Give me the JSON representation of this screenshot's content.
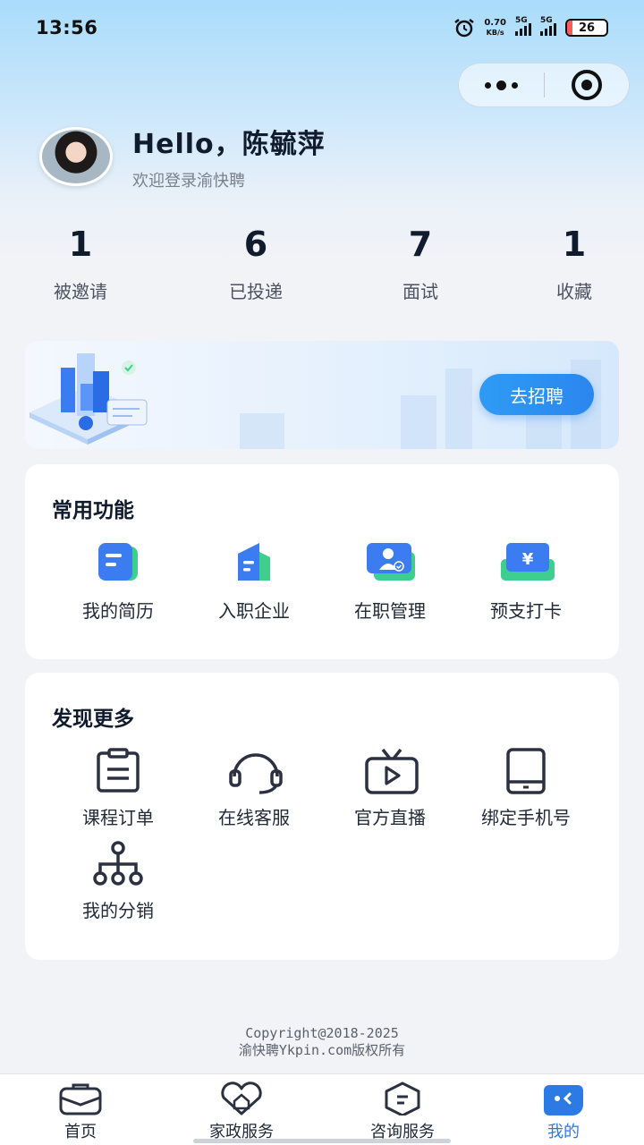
{
  "status_bar": {
    "time": "13:56",
    "net_speed_value": "0.70",
    "net_speed_unit": "KB/s",
    "signal1_label": "5G",
    "signal2_label": "5G",
    "battery": "26"
  },
  "profile": {
    "greeting": "Hello，陈毓萍",
    "welcome": "欢迎登录渝快聘"
  },
  "stats": [
    {
      "value": "1",
      "label": "被邀请"
    },
    {
      "value": "6",
      "label": "已投递"
    },
    {
      "value": "7",
      "label": "面试"
    },
    {
      "value": "1",
      "label": "收藏"
    }
  ],
  "banner": {
    "button_label": "去招聘"
  },
  "common_functions": {
    "title": "常用功能",
    "items": [
      {
        "label": "我的简历",
        "icon": "resume-icon"
      },
      {
        "label": "入职企业",
        "icon": "building-icon"
      },
      {
        "label": "在职管理",
        "icon": "employee-card-icon"
      },
      {
        "label": "预支打卡",
        "icon": "yen-card-icon"
      }
    ]
  },
  "discover_more": {
    "title": "发现更多",
    "items": [
      {
        "label": "课程订单",
        "icon": "clipboard-icon"
      },
      {
        "label": "在线客服",
        "icon": "headset-icon"
      },
      {
        "label": "官方直播",
        "icon": "tv-play-icon"
      },
      {
        "label": "绑定手机号",
        "icon": "phone-icon"
      },
      {
        "label": "我的分销",
        "icon": "network-icon"
      }
    ]
  },
  "footer": {
    "line1": "Copyright@2018-2025",
    "line2": "渝快聘Ykpin.com版权所有"
  },
  "tabbar": [
    {
      "label": "首页",
      "icon": "briefcase-icon",
      "active": false
    },
    {
      "label": "家政服务",
      "icon": "heart-house-icon",
      "active": false
    },
    {
      "label": "咨询服务",
      "icon": "hexagon-chat-icon",
      "active": false
    },
    {
      "label": "我的",
      "icon": "profile-face-icon",
      "active": true
    }
  ],
  "colors": {
    "accent": "#2c7be5",
    "icon_blue": "#3b7cf0",
    "icon_green": "#3ecf8e",
    "text_dark": "#111b2e"
  }
}
